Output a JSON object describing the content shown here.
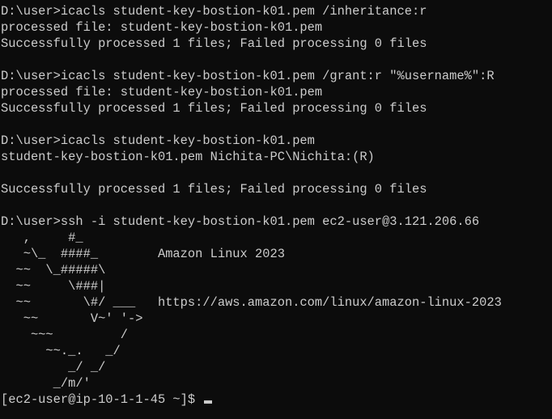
{
  "terminal": {
    "lines": [
      "D:\\user>icacls student-key-bostion-k01.pem /inheritance:r",
      "processed file: student-key-bostion-k01.pem",
      "Successfully processed 1 files; Failed processing 0 files",
      "",
      "D:\\user>icacls student-key-bostion-k01.pem /grant:r \"%username%\":R",
      "processed file: student-key-bostion-k01.pem",
      "Successfully processed 1 files; Failed processing 0 files",
      "",
      "D:\\user>icacls student-key-bostion-k01.pem",
      "student-key-bostion-k01.pem Nichita-PC\\Nichita:(R)",
      "",
      "Successfully processed 1 files; Failed processing 0 files",
      "",
      "D:\\user>ssh -i student-key-bostion-k01.pem ec2-user@3.121.206.66",
      "   ,     #_",
      "   ~\\_  ####_        Amazon Linux 2023",
      "  ~~  \\_#####\\",
      "  ~~     \\###|",
      "  ~~       \\#/ ___   https://aws.amazon.com/linux/amazon-linux-2023",
      "   ~~       V~' '->",
      "    ~~~         /",
      "      ~~._.   _/",
      "         _/ _/",
      "       _/m/'"
    ],
    "prompt": "[ec2-user@ip-10-1-1-45 ~]$ "
  }
}
